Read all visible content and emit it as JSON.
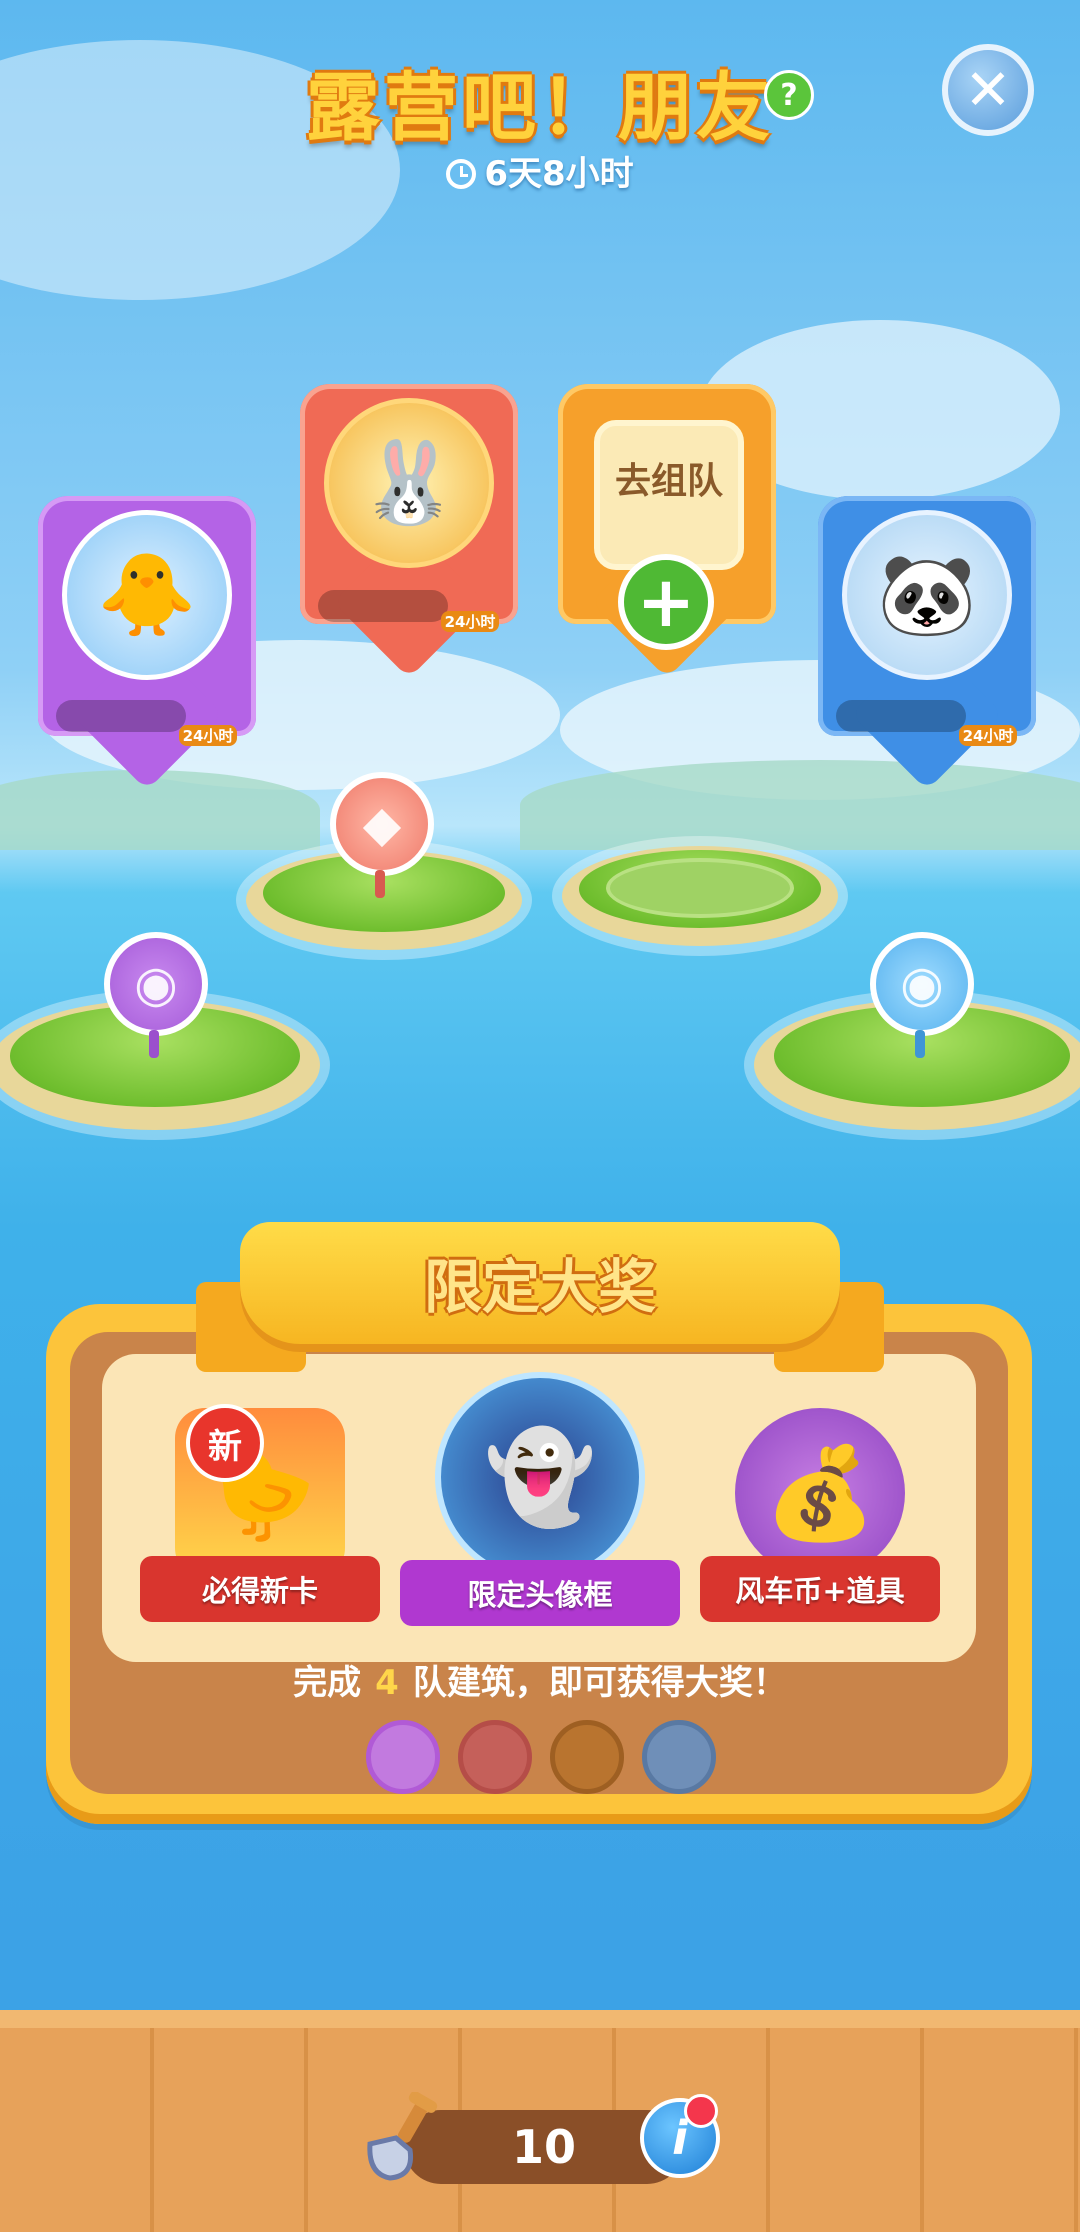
{
  "header": {
    "title": "露营吧！朋友",
    "help_icon": "question-icon",
    "help_glyph": "?",
    "timer": "6天8小时",
    "timer_icon": "clock-icon",
    "close_icon": "close-icon",
    "close_glyph": "✕"
  },
  "teams": [
    {
      "name": "team-card-purple",
      "color": "#b463e6",
      "progress": 0,
      "badge": "24小时"
    },
    {
      "name": "team-card-red",
      "color": "#f06a55",
      "progress": 0,
      "badge": "24小时"
    },
    {
      "name": "team-card-join",
      "color": "#f6a02b",
      "label": "去组队"
    },
    {
      "name": "team-card-blue",
      "color": "#3f8fe6",
      "progress": 0,
      "badge": "24小时"
    }
  ],
  "islands": {
    "pins": [
      "owl",
      "fox",
      "empty",
      "hippo"
    ]
  },
  "grand_prize": {
    "title": "限定大奖",
    "rewards": [
      {
        "label": "必得新卡",
        "tag": "新",
        "color": "#d9352e"
      },
      {
        "label": "限定头像框",
        "color": "#b038d0"
      },
      {
        "label": "风车币+道具",
        "color": "#d9352e"
      }
    ],
    "goal_prefix": "完成",
    "goal_count": "4",
    "goal_suffix": "队建筑，即可获得大奖！",
    "slots": [
      {
        "color": "#c27adf",
        "border": "#b15ad6"
      },
      {
        "color": "#c5605a",
        "border": "#b54d48"
      },
      {
        "color": "#b9742f",
        "border": "#9e5f22"
      },
      {
        "color": "#6f8fb8",
        "border": "#5979a3"
      }
    ]
  },
  "footer": {
    "shovel_count": "10",
    "info_glyph": "i",
    "has_notification": true
  },
  "colors": {
    "accent_yellow": "#ffd23c",
    "panel": "#fcc43b"
  }
}
